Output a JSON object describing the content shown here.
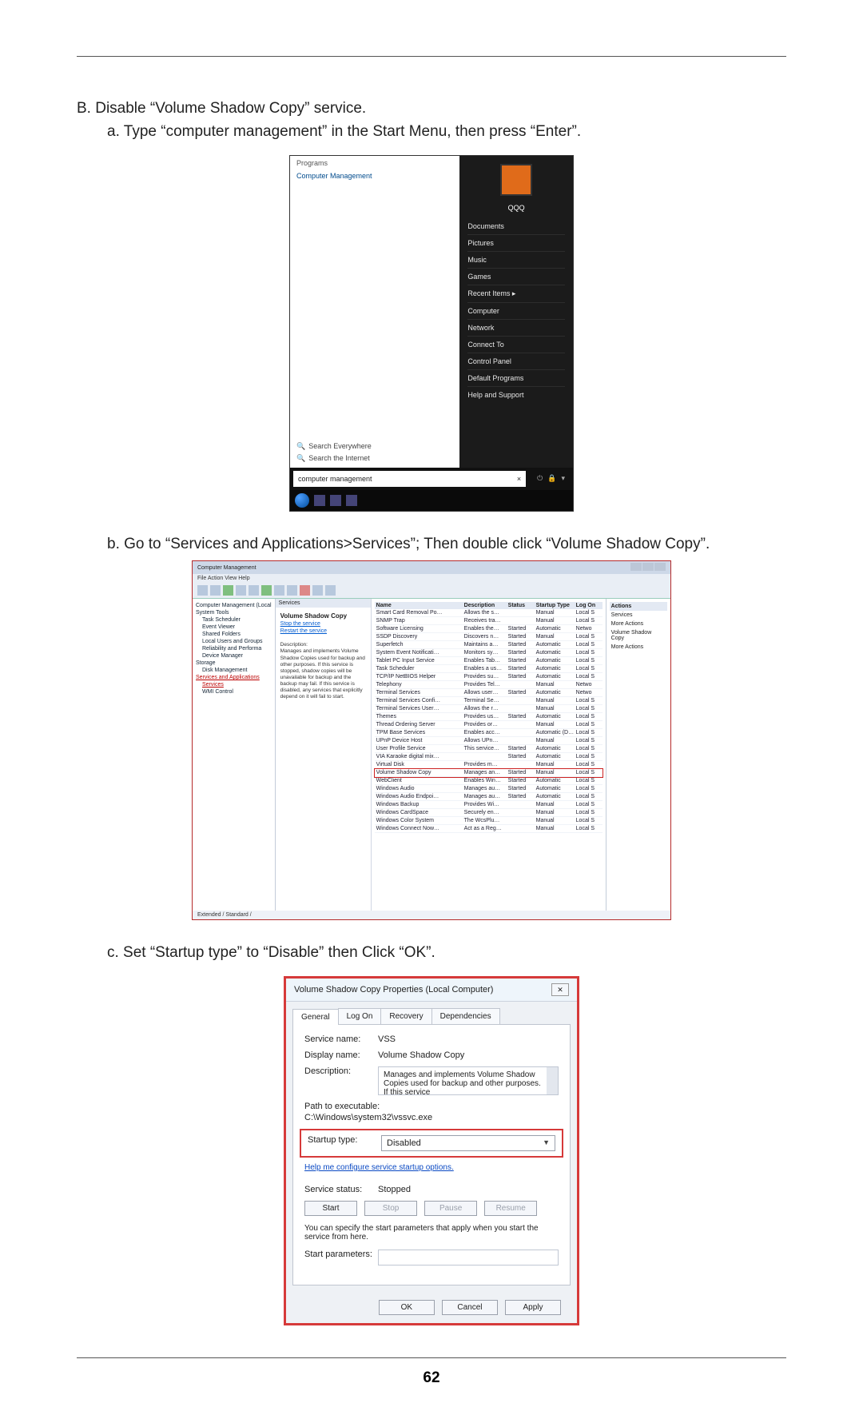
{
  "page_number": "62",
  "text": {
    "B": "B. Disable “Volume Shadow Copy” service.",
    "a": "a. Type “computer management” in the Start Menu, then press “Enter”.",
    "b": "b. Go to “Services and Applications>Services”; Then double click “Volume Shadow Copy”.",
    "c": "c. Set “Startup type” to “Disable” then Click “OK”."
  },
  "startmenu": {
    "programs_header": "Programs",
    "program_item": "Computer Management",
    "search_everywhere": "Search Everywhere",
    "search_internet": "Search the Internet",
    "search_value": "computer management",
    "search_x": "×",
    "avatar_label": "QQQ",
    "right_links": [
      "Documents",
      "Pictures",
      "Music",
      "Games",
      "Recent Items   ▸",
      "Computer",
      "Network",
      "Connect To",
      "Control Panel",
      "Default Programs",
      "Help and Support"
    ],
    "power_icon": "⏻",
    "lock_icon": "🔒",
    "menu_caret": "▾"
  },
  "mgmt": {
    "title": "Computer Management",
    "menus": "File   Action   View   Help",
    "tree": [
      "Computer Management (Local",
      "System Tools",
      "Task Scheduler",
      "Event Viewer",
      "Shared Folders",
      "Local Users and Groups",
      "Reliability and Performa",
      "Device Manager",
      "Storage",
      "Disk Management",
      "Services and Applications",
      "Services",
      "WMI Control"
    ],
    "panel_heading": "Services",
    "selected_service": "Volume Shadow Copy",
    "link_stop": "Stop the service",
    "link_restart": "Restart the service",
    "desc_label": "Description:",
    "desc": "Manages and implements Volume Shadow Copies used for backup and other purposes. If this service is stopped, shadow copies will be unavailable for backup and the backup may fail. If this service is disabled, any services that explicitly depend on it will fail to start.",
    "cols": [
      "Name",
      "Description",
      "Status",
      "Startup Type",
      "Log On"
    ],
    "rows": [
      [
        "Smart Card Removal Po…",
        "Allows the s…",
        "",
        "Manual",
        "Local S"
      ],
      [
        "SNMP Trap",
        "Receives tra…",
        "",
        "Manual",
        "Local S"
      ],
      [
        "Software Licensing",
        "Enables the…",
        "Started",
        "Automatic",
        "Netwo"
      ],
      [
        "SSDP Discovery",
        "Discovers n…",
        "Started",
        "Manual",
        "Local S"
      ],
      [
        "Superfetch",
        "Maintains a…",
        "Started",
        "Automatic",
        "Local S"
      ],
      [
        "System Event Notificati…",
        "Monitors sy…",
        "Started",
        "Automatic",
        "Local S"
      ],
      [
        "Tablet PC Input Service",
        "Enables Tab…",
        "Started",
        "Automatic",
        "Local S"
      ],
      [
        "Task Scheduler",
        "Enables a us…",
        "Started",
        "Automatic",
        "Local S"
      ],
      [
        "TCP/IP NetBIOS Helper",
        "Provides su…",
        "Started",
        "Automatic",
        "Local S"
      ],
      [
        "Telephony",
        "Provides Tel…",
        "",
        "Manual",
        "Netwo"
      ],
      [
        "Terminal Services",
        "Allows user…",
        "Started",
        "Automatic",
        "Netwo"
      ],
      [
        "Terminal Services Confi…",
        "Terminal Se…",
        "",
        "Manual",
        "Local S"
      ],
      [
        "Terminal Services User…",
        "Allows the r…",
        "",
        "Manual",
        "Local S"
      ],
      [
        "Themes",
        "Provides us…",
        "Started",
        "Automatic",
        "Local S"
      ],
      [
        "Thread Ordering Server",
        "Provides or…",
        "",
        "Manual",
        "Local S"
      ],
      [
        "TPM Base Services",
        "Enables acc…",
        "",
        "Automatic (D…",
        "Local S"
      ],
      [
        "UPnP Device Host",
        "Allows UPn…",
        "",
        "Manual",
        "Local S"
      ],
      [
        "User Profile Service",
        "This service…",
        "Started",
        "Automatic",
        "Local S"
      ],
      [
        "VIA Karaoke digital mix…",
        "",
        "Started",
        "Automatic",
        "Local S"
      ],
      [
        "Virtual Disk",
        "Provides m…",
        "",
        "Manual",
        "Local S"
      ],
      [
        "Volume Shadow Copy",
        "Manages an…",
        "Started",
        "Manual",
        "Local S"
      ],
      [
        "WebClient",
        "Enables Win…",
        "Started",
        "Automatic",
        "Local S"
      ],
      [
        "Windows Audio",
        "Manages au…",
        "Started",
        "Automatic",
        "Local S"
      ],
      [
        "Windows Audio Endpoi…",
        "Manages au…",
        "Started",
        "Automatic",
        "Local S"
      ],
      [
        "Windows Backup",
        "Provides Wi…",
        "",
        "Manual",
        "Local S"
      ],
      [
        "Windows CardSpace",
        "Securely en…",
        "",
        "Manual",
        "Local S"
      ],
      [
        "Windows Color System",
        "The WcsPlu…",
        "",
        "Manual",
        "Local S"
      ],
      [
        "Windows Connect Now…",
        "Act as a Reg…",
        "",
        "Manual",
        "Local S"
      ]
    ],
    "tabs": "Extended / Standard /",
    "actions_header": "Actions",
    "actions_items": [
      "Services",
      "More Actions",
      "Volume Shadow Copy",
      "More Actions"
    ]
  },
  "props": {
    "title": "Volume Shadow Copy Properties (Local Computer)",
    "tabs": [
      "General",
      "Log On",
      "Recovery",
      "Dependencies"
    ],
    "lab_service_name": "Service name:",
    "service_name": "VSS",
    "lab_display_name": "Display name:",
    "display_name": "Volume Shadow Copy",
    "lab_description": "Description:",
    "description": "Manages and implements Volume Shadow Copies used for backup and other purposes. If this service",
    "lab_path": "Path to executable:",
    "path": "C:\\Windows\\system32\\vssvc.exe",
    "lab_startup": "Startup type:",
    "startup_value": "Disabled",
    "help_link": "Help me configure service startup options.",
    "lab_status": "Service status:",
    "status": "Stopped",
    "btn_start": "Start",
    "btn_stop": "Stop",
    "btn_pause": "Pause",
    "btn_resume": "Resume",
    "hint": "You can specify the start parameters that apply when you start the service from here.",
    "lab_params": "Start parameters:",
    "btn_ok": "OK",
    "btn_cancel": "Cancel",
    "btn_apply": "Apply"
  }
}
